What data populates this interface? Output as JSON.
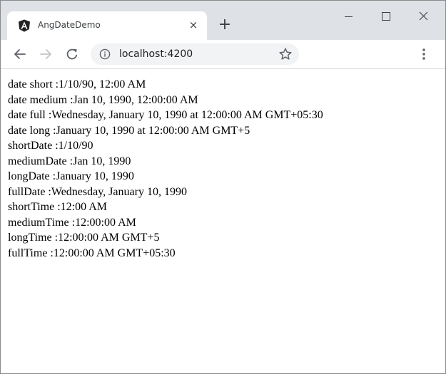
{
  "browser": {
    "tab_title": "AngDateDemo",
    "tab_close_glyph": "×",
    "new_tab_glyph": "+",
    "url": "localhost:4200",
    "icons": {
      "favicon": "angular-logo-icon",
      "back": "arrow-left-icon",
      "forward": "arrow-right-icon",
      "reload": "reload-icon",
      "site_info": "info-icon",
      "bookmark": "star-icon",
      "menu": "three-dots-menu-icon",
      "minimize": "minimize-icon",
      "maximize": "maximize-icon",
      "close": "close-icon"
    },
    "colors": {
      "tabstrip": "#dee1e6",
      "omnibox": "#f1f3f4",
      "favicon": "#212121",
      "forward_disabled": "#c2c4c8"
    }
  },
  "page": {
    "lines": [
      "date short :1/10/90, 12:00 AM",
      "date medium :Jan 10, 1990, 12:00:00 AM",
      "date full :Wednesday, January 10, 1990 at 12:00:00 AM GMT+05:30",
      "date long :January 10, 1990 at 12:00:00 AM GMT+5",
      "shortDate :1/10/90",
      "mediumDate :Jan 10, 1990",
      "longDate :January 10, 1990",
      "fullDate :Wednesday, January 10, 1990",
      "shortTime :12:00 AM",
      "mediumTime :12:00:00 AM",
      "longTime :12:00:00 AM GMT+5",
      "fullTime :12:00:00 AM GMT+05:30"
    ]
  }
}
